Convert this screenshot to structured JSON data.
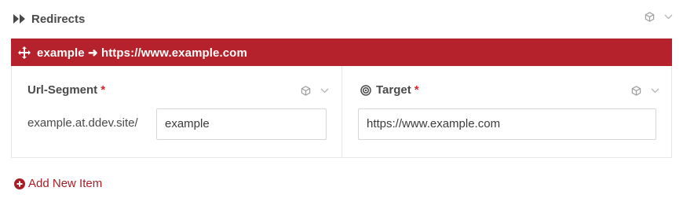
{
  "section": {
    "title": "Redirects",
    "icon": "fast-forward-icon"
  },
  "item": {
    "title": "example ➜ https://www.example.com",
    "accent": "#b5222b",
    "icon": "move-arrows-icon"
  },
  "fields": {
    "url_segment": {
      "label": "Url-Segment",
      "required_mark": "*",
      "prefix": "example.at.ddev.site/",
      "value": "example"
    },
    "target": {
      "label": "Target",
      "required_mark": "*",
      "icon": "target-icon",
      "value": "https://www.example.com"
    }
  },
  "actions": {
    "add_new_item": "Add New Item",
    "add_icon": "plus-circle-icon"
  },
  "colors": {
    "brand_red": "#b5222b",
    "link_red": "#a61e26",
    "required_red": "#d22b2b"
  }
}
